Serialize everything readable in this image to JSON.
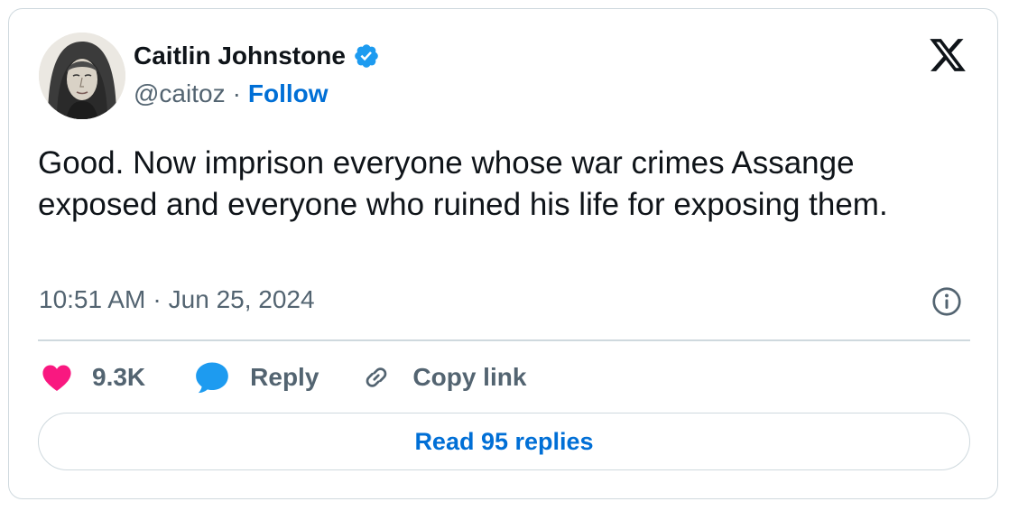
{
  "author": {
    "display_name": "Caitlin Johnstone",
    "handle": "@caitoz",
    "separator": "·",
    "follow_label": "Follow",
    "verified": true
  },
  "tweet": {
    "text": "Good. Now imprison everyone whose war crimes Assange exposed and everyone who ruined his life for exposing them.",
    "time": "10:51 AM",
    "date": "Jun 25, 2024",
    "separator": "·"
  },
  "actions": {
    "likes": "9.3K",
    "reply_label": "Reply",
    "copy_link_label": "Copy link"
  },
  "read_replies_label": "Read 95 replies",
  "colors": {
    "accent_blue": "#006fd6",
    "verified_blue": "#1d9bf0",
    "like_pink": "#f91880",
    "reply_blue": "#1d9bf0",
    "text_primary": "#0f1419",
    "text_secondary": "#536471",
    "border": "#cfd9de"
  },
  "icons": {
    "logo": "x-logo-icon",
    "verified": "verified-badge-icon",
    "info": "info-icon",
    "like": "heart-icon",
    "reply": "speech-bubble-icon",
    "copy_link": "link-icon"
  }
}
